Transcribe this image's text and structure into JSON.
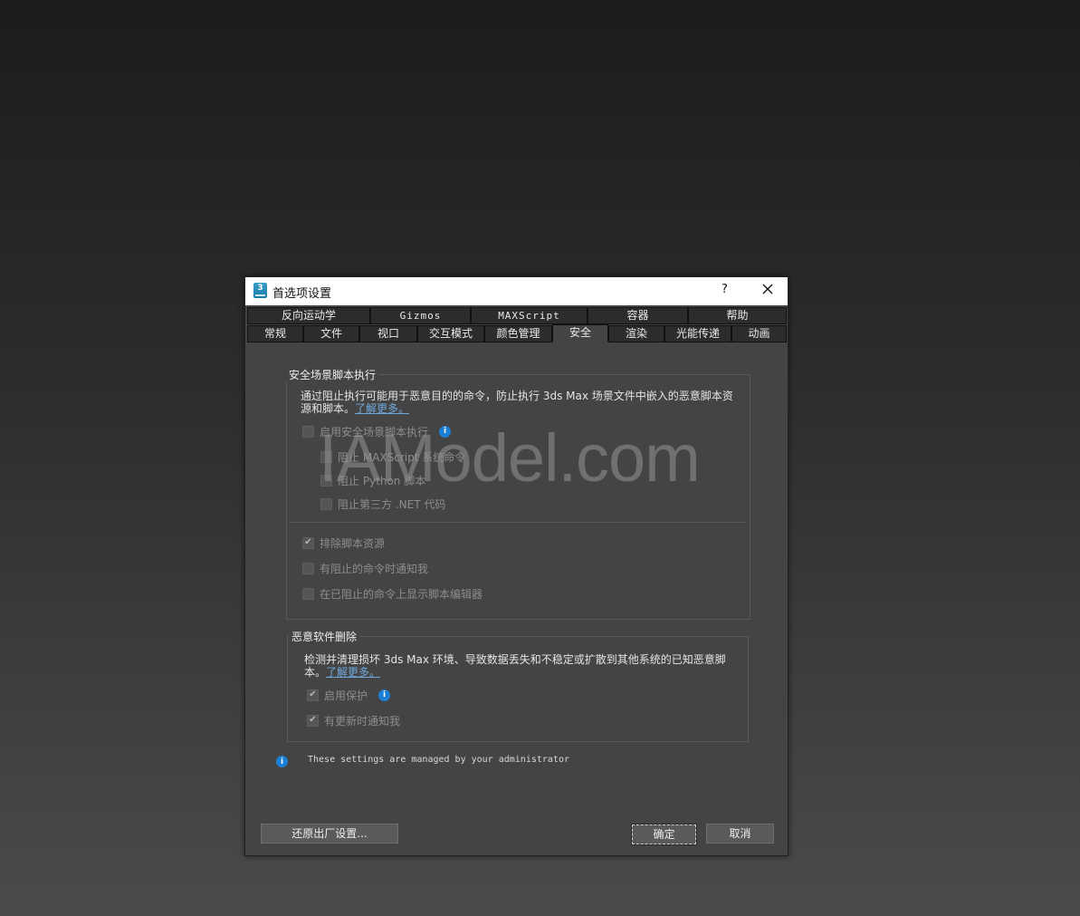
{
  "dialog": {
    "title": "首选项设置",
    "help_label": "?",
    "app_icon_text": "3"
  },
  "tabs_row1": [
    "反向运动学",
    "Gizmos",
    "MAXScript",
    "容器",
    "帮助"
  ],
  "tabs_row2": [
    "常规",
    "文件",
    "视口",
    "交互模式",
    "颜色管理",
    "安全",
    "渲染",
    "光能传递",
    "动画"
  ],
  "active_tab": "安全",
  "secure_scene": {
    "title": "安全场景脚本执行",
    "description_line1": "通过阻止执行可能用于恶意目的的命令，防止执行 3ds Max 场景文件中嵌入的恶意脚本资",
    "description_line2": "源和脚本。",
    "learn_more": "了解更多。",
    "enable_label": "启用安全场景脚本执行",
    "block_maxscript": "阻止 MAXScript 系统命令",
    "block_python": "阻止 Python 脚本",
    "block_dotnet": "阻止第三方 .NET 代码",
    "exclude_script_assets": "排除脚本资源",
    "notify_blocked": "有阻止的命令时通知我",
    "show_editor_blocked": "在已阻止的命令上显示脚本编辑器"
  },
  "malware": {
    "title": "恶意软件删除",
    "description_line1": "检测并清理损坏 3ds Max 环境、导致数据丢失和不稳定或扩散到其他系统的已知恶意脚",
    "description_line2": "本。",
    "learn_more": "了解更多。",
    "enable_protection": "启用保护",
    "notify_updates": "有更新时通知我"
  },
  "admin_note": "These settings are managed by your administrator",
  "buttons": {
    "reset": "还原出厂设置...",
    "ok": "确定",
    "cancel": "取消"
  },
  "watermark": "IAModel.com",
  "colors": {
    "accent": "#1b7fd4",
    "link": "#6fa8dc",
    "panel": "#444444"
  }
}
